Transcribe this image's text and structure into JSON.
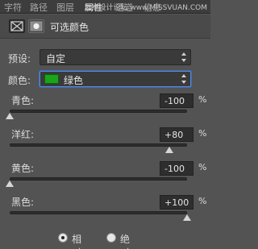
{
  "tabs": [
    {
      "label": "字符"
    },
    {
      "label": "路径"
    },
    {
      "label": "图层"
    },
    {
      "label": "属性"
    },
    {
      "label": "通道"
    },
    {
      "label": "信息"
    }
  ],
  "watermark": "思缘设计论坛 www.MISSVUAN.COM",
  "panel_title": "可选颜色",
  "preset": {
    "label": "预设:",
    "value": "自定"
  },
  "colors": {
    "label": "颜色:",
    "value": "绿色",
    "swatch": "#1aa51a"
  },
  "channels": [
    {
      "label": "青色:",
      "value": "-100",
      "unit": "%",
      "level": -100
    },
    {
      "label": "洋红:",
      "value": "+80",
      "unit": "%",
      "level": 80
    },
    {
      "label": "黄色:",
      "value": "-100",
      "unit": "%",
      "level": -100
    },
    {
      "label": "黑色:",
      "value": "+100",
      "unit": "%",
      "level": 100
    }
  ],
  "mode": {
    "relative": "相对",
    "absolute": "绝对",
    "selected": "relative"
  }
}
